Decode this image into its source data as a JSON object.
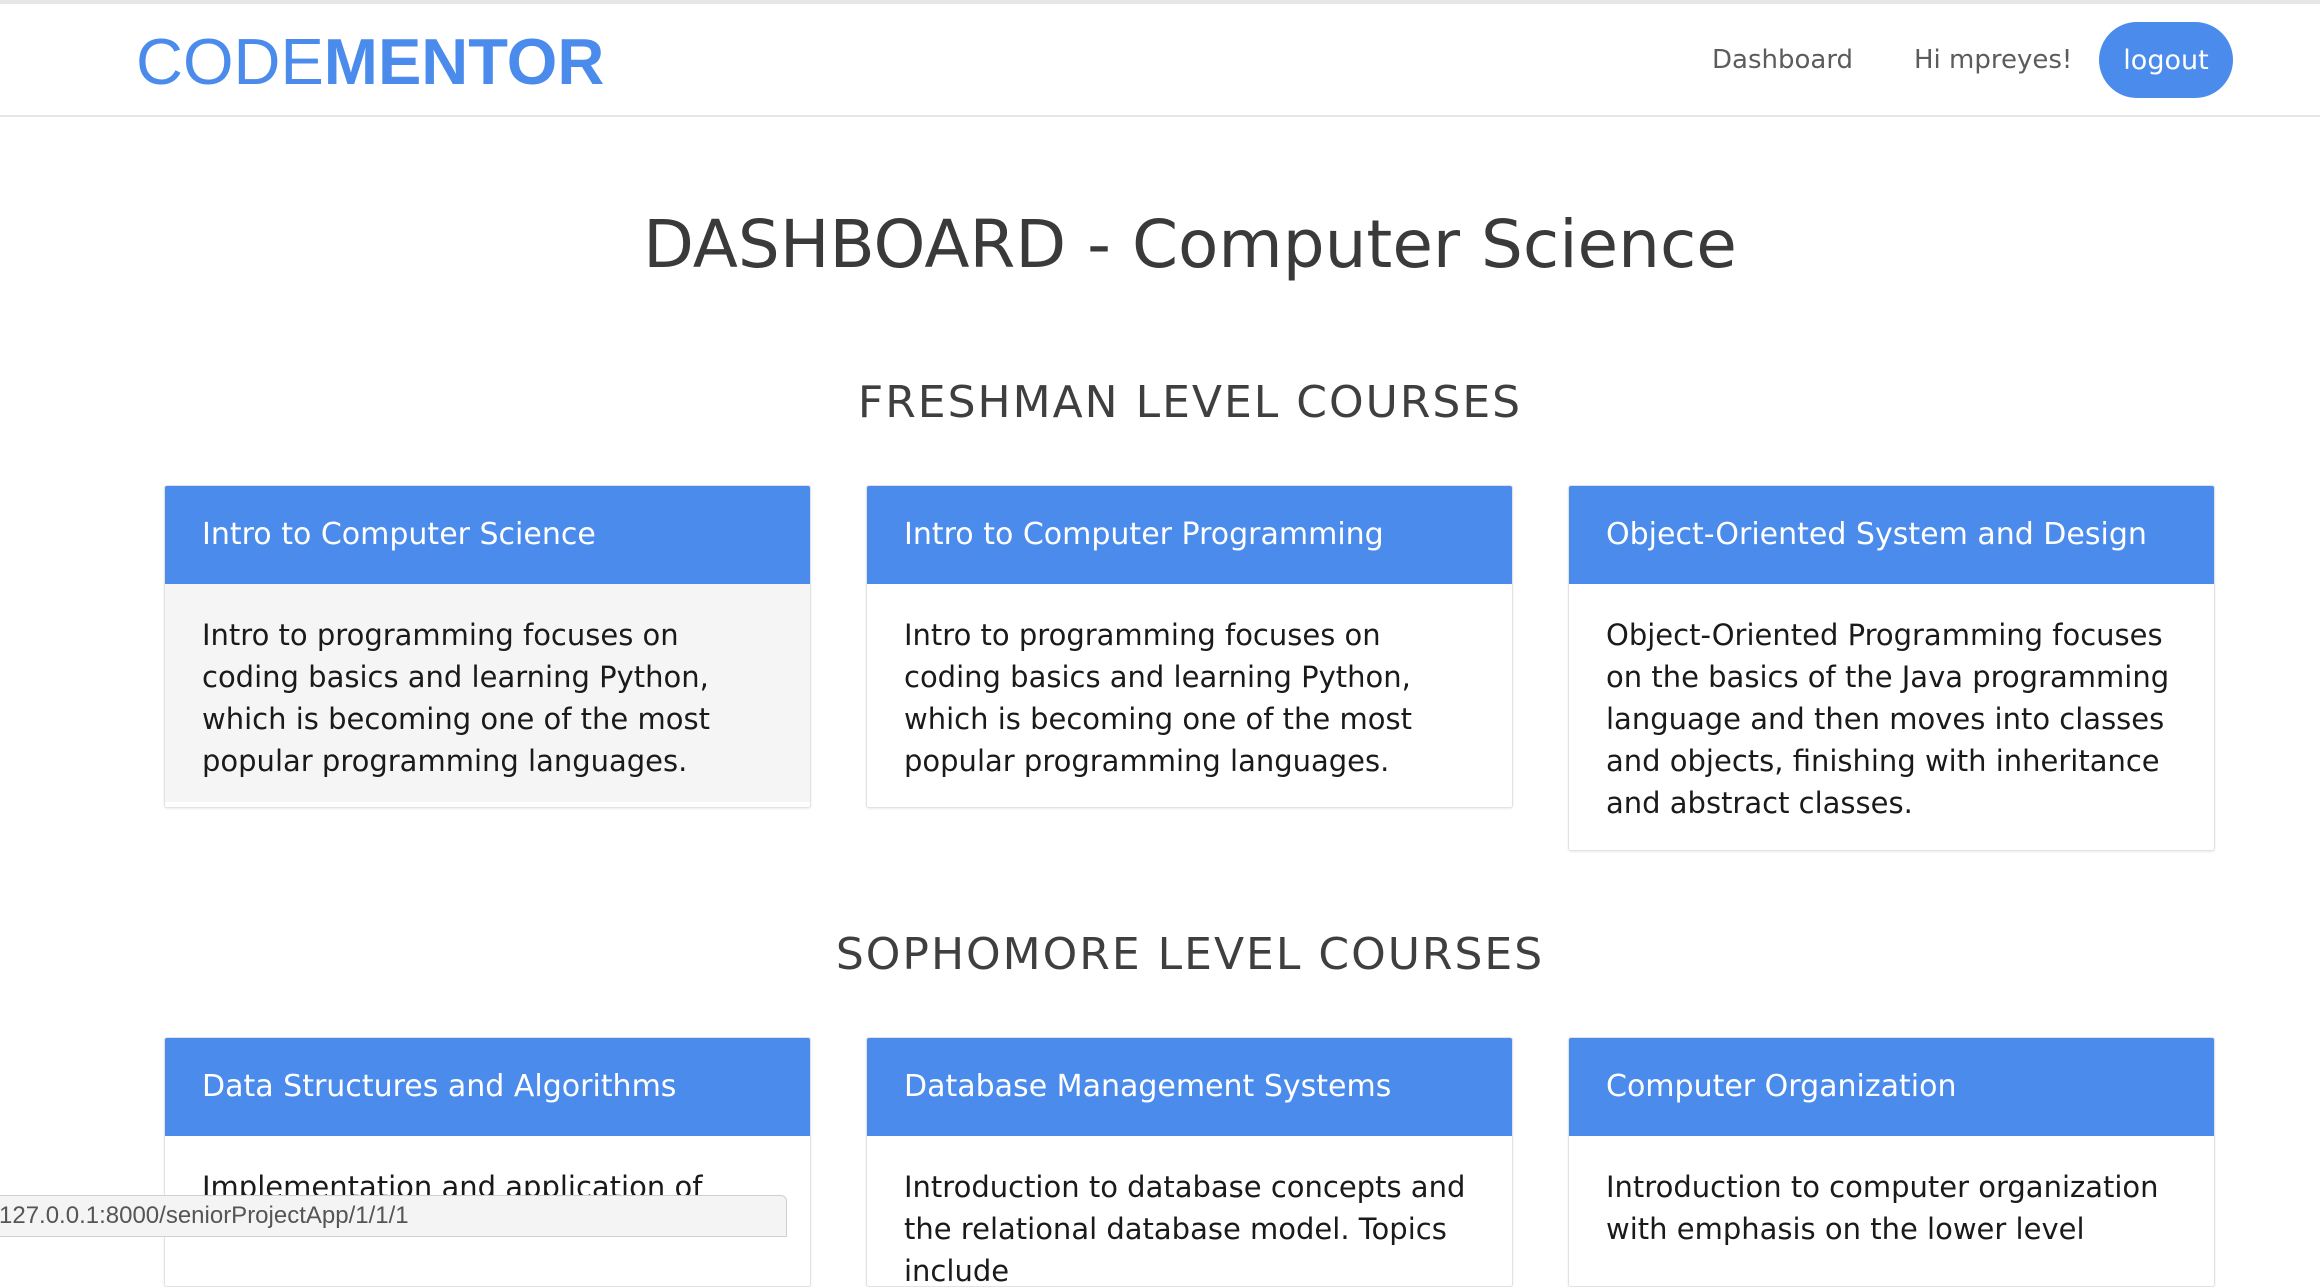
{
  "brand": {
    "part1": "CODE",
    "part2": "MENTOR"
  },
  "nav": {
    "dashboard": "Dashboard",
    "greeting": "Hi mpreyes!",
    "logout": "logout"
  },
  "page_title": "DASHBOARD - Computer Science",
  "sections": [
    {
      "title": "FRESHMAN LEVEL COURSES",
      "courses": [
        {
          "title": "Intro to Computer Science",
          "description": "Intro to programming focuses on coding basics and learning Python, which is becoming one of the most popular programming languages."
        },
        {
          "title": "Intro to Computer Programming",
          "description": "Intro to programming focuses on coding basics and learning Python, which is becoming one of the most popular programming languages."
        },
        {
          "title": "Object-Oriented System and Design",
          "description": "Object-Oriented Programming focuses on the basics of the Java programming language and then moves into classes and objects, finishing with inheritance and abstract classes."
        }
      ]
    },
    {
      "title": "SOPHOMORE LEVEL COURSES",
      "courses": [
        {
          "title": "Data Structures and Algorithms",
          "description": "Implementation and application of"
        },
        {
          "title": "Database Management Systems",
          "description": "Introduction to database concepts and the relational database model. Topics include"
        },
        {
          "title": "Computer Organization",
          "description": "Introduction to computer organization with emphasis on the lower level"
        }
      ]
    }
  ],
  "status_bar": {
    "url": "127.0.0.1:8000/seniorProjectApp/1/1/1"
  },
  "colors": {
    "accent": "#4a8bec",
    "text": "#222222",
    "card_hover_bg": "#f5f5f5"
  }
}
